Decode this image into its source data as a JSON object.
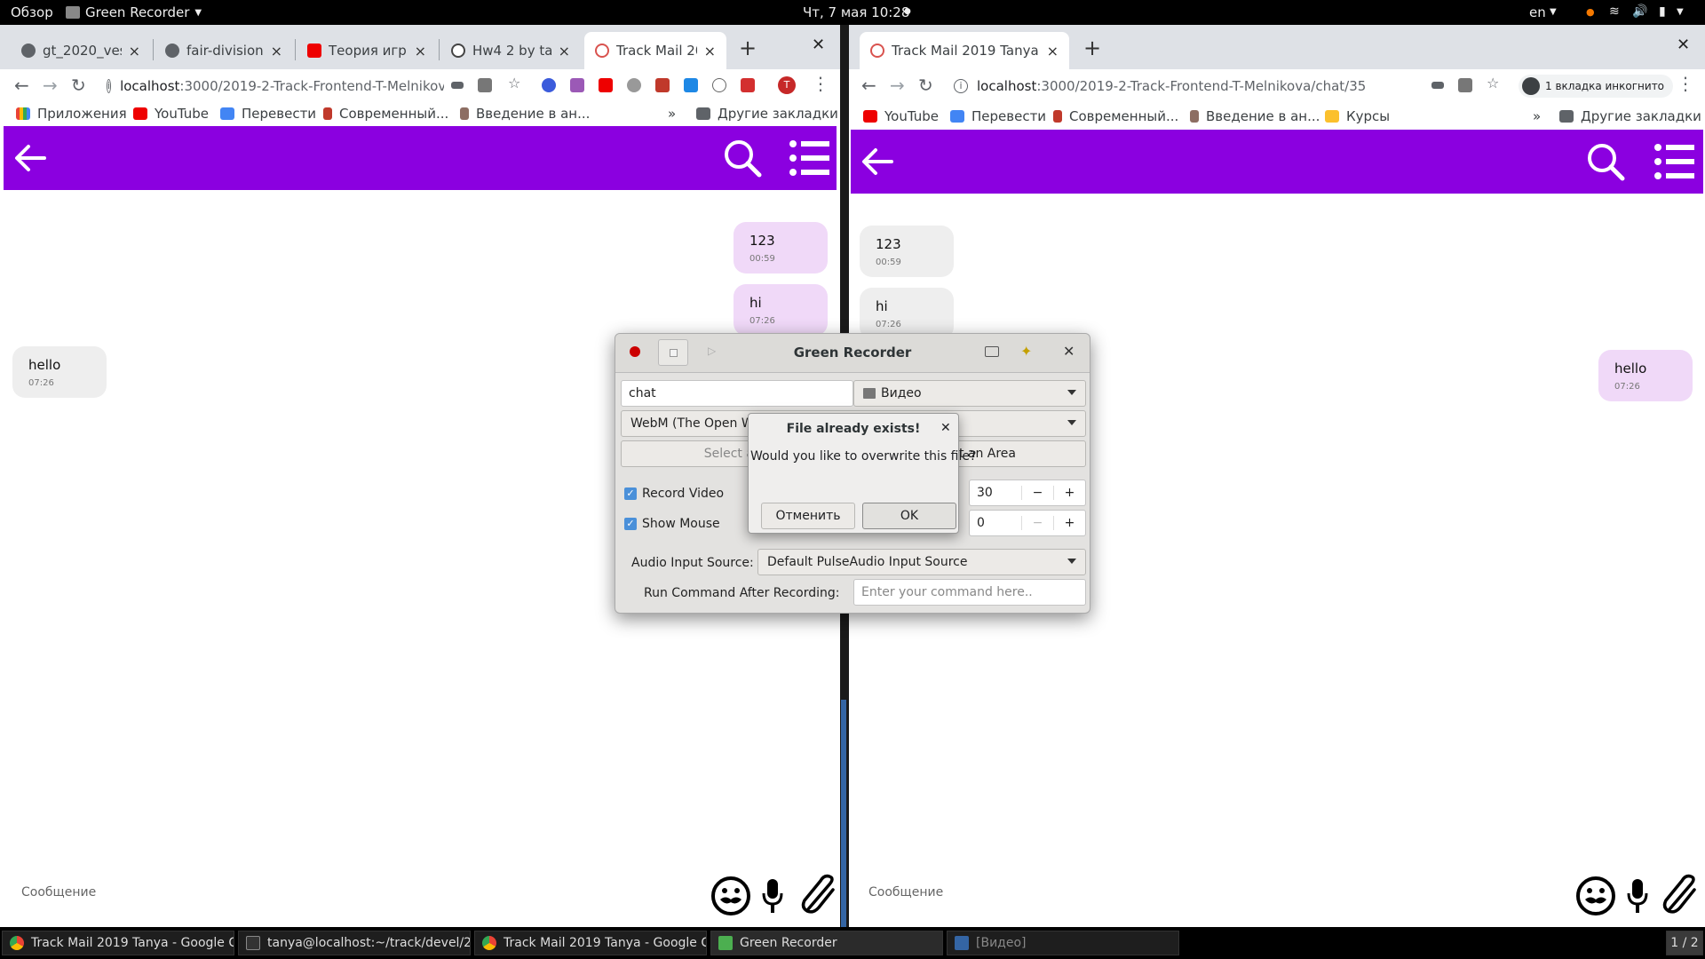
{
  "topbar": {
    "activities": "Обзор",
    "app": "Green Recorder",
    "clock": "Чт, 7 мая  10:28",
    "lang": "en"
  },
  "left_browser": {
    "tabs": [
      {
        "label": "gt_2020_vesn",
        "favicon": "globe-icon"
      },
      {
        "label": "fair-division-",
        "favicon": "globe-icon"
      },
      {
        "label": "Теория игр 2.",
        "favicon": "youtube-icon"
      },
      {
        "label": "Hw4 2 by tany",
        "favicon": "github-icon"
      },
      {
        "label": "Track Mail 201",
        "favicon": "app-icon",
        "active": true
      }
    ],
    "url_host": "localhost",
    "url_path": ":3000/2019-2-Track-Frontend-T-Melnikova/...",
    "profile_letter": "T",
    "bookmarks": [
      "Приложения",
      "YouTube",
      "Перевести",
      "Современный...",
      "Введение в ан..."
    ],
    "other_bookmarks": "Другие закладки",
    "messages": [
      {
        "text": "123",
        "time": "00:59",
        "mine": true
      },
      {
        "text": "hi",
        "time": "07:26",
        "mine": true
      },
      {
        "text": "hello",
        "time": "07:26",
        "mine": false
      }
    ],
    "compose_placeholder": "Сообщение"
  },
  "right_browser": {
    "tab_label": "Track Mail 2019 Tanya",
    "url_host": "localhost",
    "url_path": ":3000/2019-2-Track-Frontend-T-Melnikova/chat/35",
    "incognito": "1 вкладка инкогнито",
    "bookmarks": [
      "YouTube",
      "Перевести",
      "Современный...",
      "Введение в ан...",
      "Курсы"
    ],
    "other_bookmarks": "Другие закладки",
    "messages": [
      {
        "text": "123",
        "time": "00:59",
        "mine": false
      },
      {
        "text": "hi",
        "time": "07:26",
        "mine": false
      },
      {
        "text": "hello",
        "time": "07:26",
        "mine": true
      }
    ],
    "compose_placeholder": "Сообщение"
  },
  "recorder": {
    "title": "Green Recorder",
    "filename": "chat",
    "folder": "Видео",
    "format": "WebM (The Open W",
    "select_window": "Select a W",
    "select_area": "t an Area",
    "record_video": "Record Video",
    "show_mouse": "Show Mouse",
    "fps": "30",
    "delay": "0",
    "minus": "−",
    "plus": "+",
    "audio_label": "Audio Input Source:",
    "audio_value": "Default PulseAudio Input Source",
    "command_label": "Run Command After Recording:",
    "command_placeholder": "Enter your command here.."
  },
  "dialog": {
    "title": "File already exists!",
    "message": "Would you like to overwrite this file?",
    "cancel": "Отменить",
    "ok": "OK"
  },
  "taskbar": {
    "items": [
      "Track Mail 2019 Tanya - Google C...",
      "tanya@localhost:~/track/devel/20...",
      "Track Mail 2019 Tanya - Google C...",
      "Green Recorder",
      "[Видео]"
    ],
    "workspace": "1 / 2"
  },
  "colors": {
    "app_header": "#8b00e0",
    "my_bubble": "#f0d9f8",
    "other_bubble": "#eeeeee"
  }
}
